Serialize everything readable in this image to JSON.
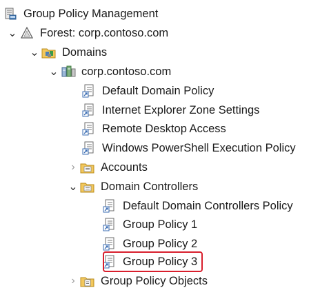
{
  "accent": "#d81e2c",
  "tree": {
    "root": {
      "label": "Group Policy Management",
      "icon": "gpm-console-icon"
    },
    "forest": {
      "label": "Forest: corp.contoso.com",
      "icon": "forest-icon",
      "expanded": true
    },
    "domains": {
      "label": "Domains",
      "icon": "domains-folder-icon",
      "expanded": true
    },
    "domain": {
      "label": "corp.contoso.com",
      "icon": "domain-icon",
      "expanded": true
    },
    "links": [
      {
        "label": "Default Domain Policy",
        "icon": "gpo-link-icon"
      },
      {
        "label": "Internet Explorer Zone Settings",
        "icon": "gpo-link-icon"
      },
      {
        "label": "Remote Desktop Access",
        "icon": "gpo-link-icon"
      },
      {
        "label": "Windows PowerShell Execution Policy",
        "icon": "gpo-link-icon"
      }
    ],
    "accounts": {
      "label": "Accounts",
      "icon": "ou-folder-icon",
      "expanded": false
    },
    "domain_controllers": {
      "label": "Domain Controllers",
      "icon": "ou-folder-icon",
      "expanded": true,
      "links": [
        {
          "label": "Default Domain Controllers Policy",
          "icon": "gpo-link-icon"
        },
        {
          "label": "Group Policy 1",
          "icon": "gpo-link-icon"
        },
        {
          "label": "Group Policy 2",
          "icon": "gpo-link-icon"
        },
        {
          "label": "Group Policy 3",
          "icon": "gpo-link-icon",
          "selected": true
        }
      ]
    },
    "gpo_container": {
      "label": "Group Policy Objects",
      "icon": "gpo-container-icon",
      "expanded": false
    }
  }
}
